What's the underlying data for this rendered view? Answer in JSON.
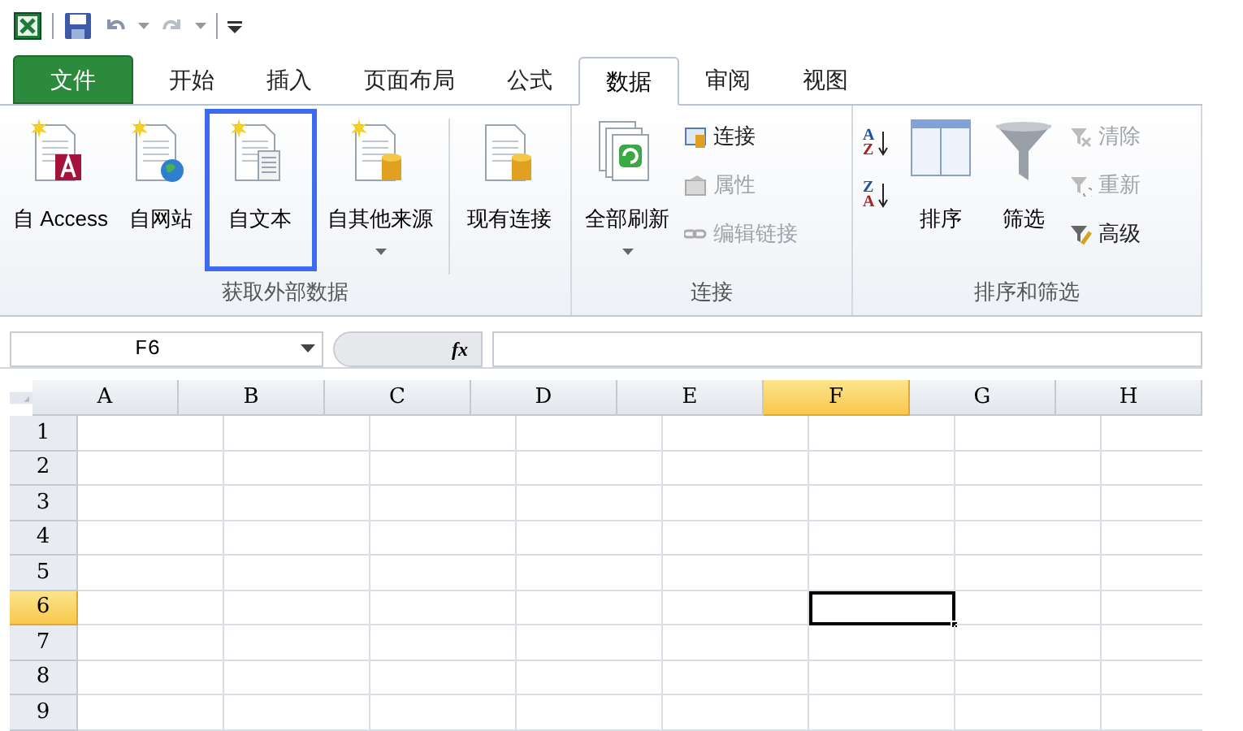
{
  "tabs": [
    {
      "label": "文件",
      "kind": "file",
      "selected": false
    },
    {
      "label": "开始",
      "kind": "tab",
      "selected": false
    },
    {
      "label": "插入",
      "kind": "tab",
      "selected": false
    },
    {
      "label": "页面布局",
      "kind": "tab",
      "selected": false
    },
    {
      "label": "公式",
      "kind": "tab",
      "selected": false
    },
    {
      "label": "数据",
      "kind": "tab",
      "selected": true
    },
    {
      "label": "审阅",
      "kind": "tab",
      "selected": false
    },
    {
      "label": "视图",
      "kind": "tab",
      "selected": false
    }
  ],
  "ribbon_groups": [
    {
      "label": "获取外部数据",
      "items": [
        {
          "kind": "large",
          "label": "自 Access",
          "dropdown": false,
          "highlighted": false
        },
        {
          "kind": "large",
          "label": "自网站",
          "dropdown": false,
          "highlighted": false
        },
        {
          "kind": "large",
          "label": "自文本",
          "dropdown": false,
          "highlighted": true
        },
        {
          "kind": "large",
          "label": "自其他来源",
          "dropdown": true,
          "highlighted": false
        },
        {
          "kind": "large",
          "label": "现有连接",
          "dropdown": false,
          "highlighted": false
        }
      ]
    },
    {
      "label": "连接",
      "items": [
        {
          "kind": "large",
          "label": "全部刷新",
          "dropdown": true,
          "highlighted": false
        },
        {
          "kind": "small",
          "label": "连接",
          "disabled": false
        },
        {
          "kind": "small",
          "label": "属性",
          "disabled": true
        },
        {
          "kind": "small",
          "label": "编辑链接",
          "disabled": true
        }
      ]
    },
    {
      "label": "排序和筛选",
      "items": [
        {
          "kind": "sort",
          "top": "A",
          "bottom": "Z"
        },
        {
          "kind": "sort",
          "top": "Z",
          "bottom": "A"
        },
        {
          "kind": "large",
          "label": "排序",
          "dropdown": false,
          "highlighted": false
        },
        {
          "kind": "large",
          "label": "筛选",
          "dropdown": false,
          "highlighted": false
        },
        {
          "kind": "small",
          "label": "清除",
          "disabled": true
        },
        {
          "kind": "small",
          "label": "重新",
          "disabled": true
        },
        {
          "kind": "small",
          "label": "高级",
          "disabled": false
        }
      ]
    }
  ],
  "name_box": {
    "value": "F6"
  },
  "formula_bar": {
    "fx": "fx"
  },
  "sheet": {
    "columns": [
      {
        "label": "A",
        "selected": false
      },
      {
        "label": "B",
        "selected": false
      },
      {
        "label": "C",
        "selected": false
      },
      {
        "label": "D",
        "selected": false
      },
      {
        "label": "E",
        "selected": false
      },
      {
        "label": "F",
        "selected": true
      },
      {
        "label": "G",
        "selected": false
      },
      {
        "label": "H",
        "selected": false
      }
    ],
    "rows": [
      {
        "label": "1",
        "selected": false
      },
      {
        "label": "2",
        "selected": false
      },
      {
        "label": "3",
        "selected": false
      },
      {
        "label": "4",
        "selected": false
      },
      {
        "label": "5",
        "selected": false
      },
      {
        "label": "6",
        "selected": true
      },
      {
        "label": "7",
        "selected": false
      },
      {
        "label": "8",
        "selected": false
      },
      {
        "label": "9",
        "selected": false
      }
    ]
  }
}
